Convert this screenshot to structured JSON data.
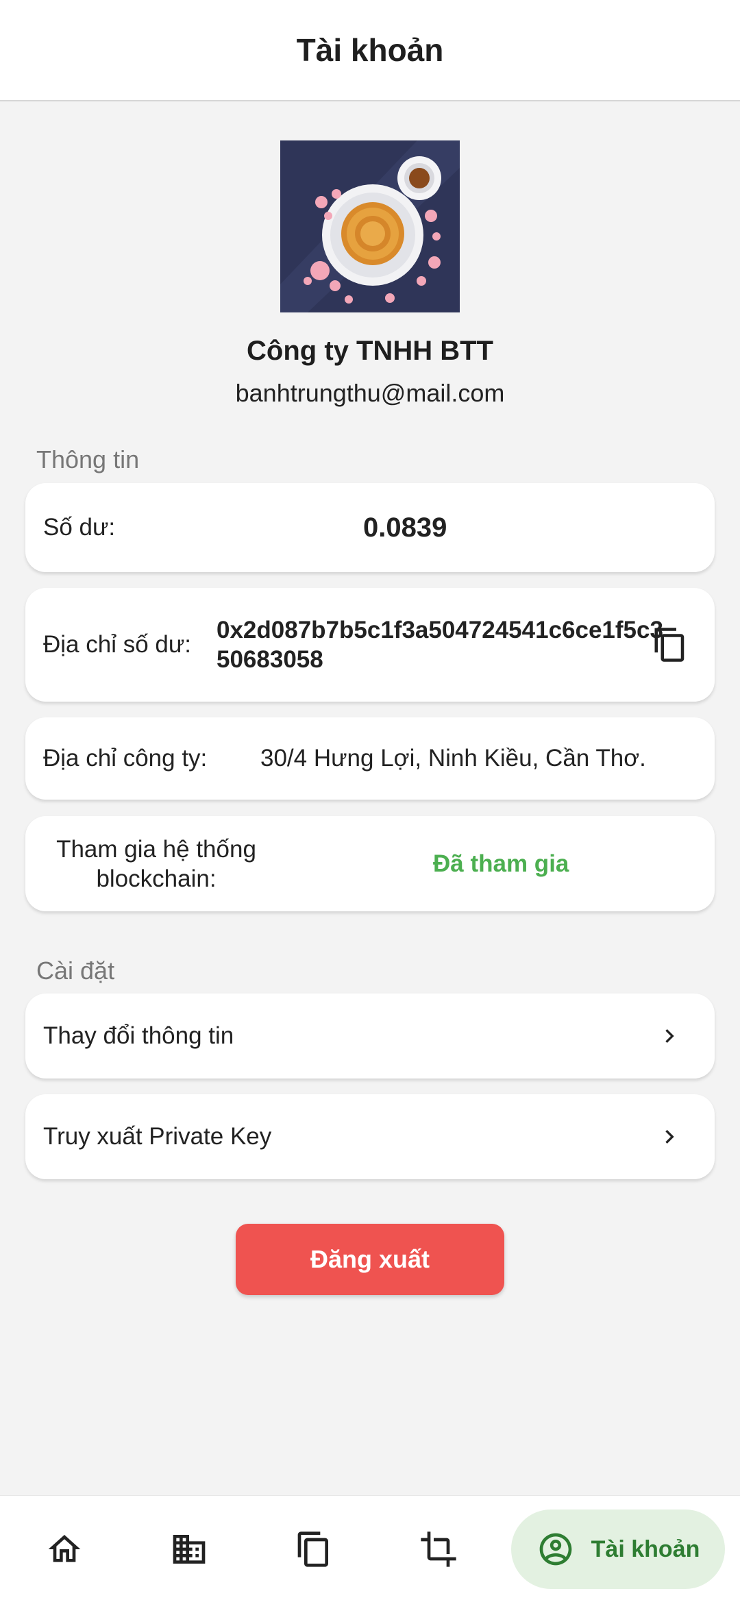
{
  "appbar": {
    "title": "Tài khoản"
  },
  "profile": {
    "company_name": "Công ty TNHH BTT",
    "email": "banhtrungthu@mail.com"
  },
  "info_section": {
    "label": "Thông tin",
    "balance_label": "Số dư:",
    "balance_value": "0.0839",
    "address_label": "Địa chỉ số dư:",
    "address_value": "0x2d087b7b5c1f3a504724541c6ce1f5c350683058",
    "company_address_label": "Địa chỉ công ty:",
    "company_address_value": "30/4 Hưng Lợi, Ninh Kiều, Cần Thơ.",
    "blockchain_label": "Tham gia hệ thống blockchain:",
    "blockchain_value": "Đã tham gia"
  },
  "settings_section": {
    "label": "Cài đặt",
    "change_info": "Thay đổi thông tin",
    "private_key": "Truy xuất Private Key"
  },
  "logout_label": "Đăng xuất",
  "nav": {
    "items": [
      {
        "icon": "home-icon"
      },
      {
        "icon": "company-icon"
      },
      {
        "icon": "copy-stack-icon"
      },
      {
        "icon": "crop-icon"
      },
      {
        "icon": "account-circle-icon",
        "label": "Tài khoản",
        "active": true
      }
    ]
  },
  "colors": {
    "accent_green": "#4caf50",
    "active_nav_bg": "#e3f1e1",
    "logout_red": "#ef5350",
    "background": "#f3f3f3"
  }
}
